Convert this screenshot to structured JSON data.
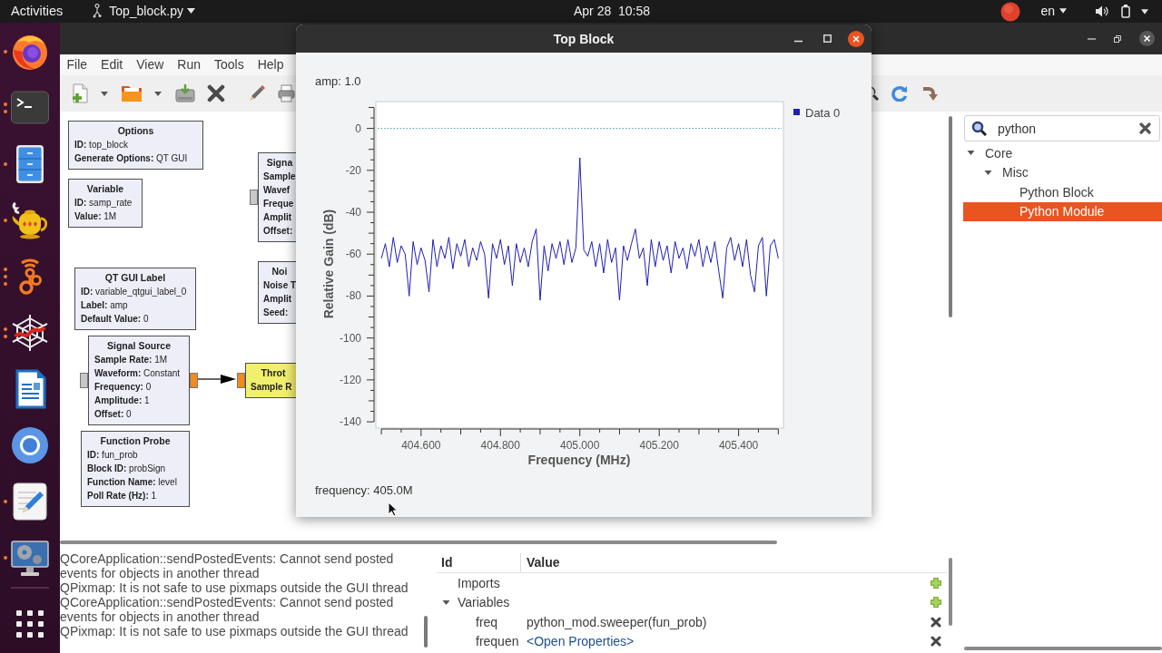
{
  "top_bar": {
    "activities": "Activities",
    "app_menu": "Top_block.py",
    "clock": "Apr 28  10:58",
    "keyboard_layout": "en"
  },
  "dock": [
    {
      "kind": "browser",
      "dots": [
        {
          "lit": true
        }
      ]
    },
    {
      "kind": "terminal",
      "dots": [
        {
          "lit": true
        },
        {
          "lit": true
        }
      ]
    },
    {
      "kind": "files",
      "dots": [
        {
          "lit": true
        }
      ]
    },
    {
      "kind": "teapot",
      "dots": [
        {
          "lit": true
        }
      ]
    },
    {
      "kind": "radio",
      "dots": [
        {
          "lit": true
        },
        {
          "lit": true
        },
        {
          "lit": true
        }
      ]
    },
    {
      "kind": "web",
      "dots": [
        {
          "lit": true
        },
        {
          "lit": true
        }
      ]
    },
    {
      "kind": "writer"
    },
    {
      "kind": "globe"
    },
    {
      "kind": "editor",
      "dots": [
        {
          "lit": true
        }
      ]
    },
    {
      "kind": "media",
      "dots": [
        {
          "lit": true
        }
      ]
    }
  ],
  "editor_window": {
    "menu": [
      "File",
      "Edit",
      "View",
      "Run",
      "Tools",
      "Help"
    ],
    "blocks": [
      {
        "title": "Options",
        "color": "#eeeef8",
        "params": [
          {
            "name": "ID:",
            "value": "top_block"
          },
          {
            "name": "Generate Options:",
            "value": "QT GUI"
          }
        ]
      },
      {
        "title": "Variable",
        "color": "#eeeef8",
        "params": [
          {
            "name": "ID:",
            "value": "samp_rate"
          },
          {
            "name": "Value:",
            "value": "1M"
          }
        ]
      },
      {
        "title": "Signa",
        "color": "#eeeef8",
        "params": [
          {
            "name": "Sample"
          },
          {
            "name": "Wavef"
          },
          {
            "name": "Freque"
          },
          {
            "name": "Amplit"
          },
          {
            "name": "Offset:"
          }
        ],
        "ports": [
          {
            "kind": "input",
            "color": "#c8c8c8"
          }
        ]
      },
      {
        "title": "QT GUI Label",
        "color": "#eeeef8",
        "params": [
          {
            "name": "ID:",
            "value": "variable_qtgui_label_0"
          },
          {
            "name": "Label:",
            "value": "amp"
          },
          {
            "name": "Default Value:",
            "value": "0"
          }
        ]
      },
      {
        "title": "Noi",
        "color": "#eeeef8",
        "params": [
          {
            "name": "Noise T"
          },
          {
            "name": "Amplit"
          },
          {
            "name": "Seed:"
          }
        ]
      },
      {
        "title": "Signal Source",
        "color": "#eeeef8",
        "params": [
          {
            "name": "Sample Rate:",
            "value": "1M"
          },
          {
            "name": "Waveform:",
            "value": "Constant"
          },
          {
            "name": "Frequency:",
            "value": "0"
          },
          {
            "name": "Amplitude:",
            "value": "1"
          },
          {
            "name": "Offset:",
            "value": "0"
          }
        ],
        "ports": [
          {
            "kind": "input",
            "color": "#c8c8c8"
          },
          {
            "kind": "output",
            "color": "#f28b1e"
          }
        ]
      },
      {
        "title": "Throt",
        "color": "#f2ee6e",
        "params": [
          {
            "name": "Sample R"
          }
        ],
        "ports": [
          {
            "kind": "input",
            "color": "#f28b1e"
          }
        ]
      },
      {
        "title": "Function Probe",
        "color": "#eeeef8",
        "params": [
          {
            "name": "ID:",
            "value": "fun_prob"
          },
          {
            "name": "Block ID:",
            "value": "probSign"
          },
          {
            "name": "Function Name:",
            "value": "level"
          },
          {
            "name": "Poll Rate (Hz):",
            "value": "1"
          }
        ]
      }
    ],
    "console": [
      "QCoreApplication::sendPostedEvents: Cannot send posted events for objects in another thread",
      "QPixmap: It is not safe to use pixmaps outside the GUI thread",
      "QCoreApplication::sendPostedEvents: Cannot send posted events for objects in another thread",
      "QPixmap: It is not safe to use pixmaps outside the GUI thread"
    ],
    "variables": {
      "columns": [
        "Id",
        "Value"
      ],
      "rows": [
        {
          "id": "Imports",
          "kind": "category"
        },
        {
          "id": "Variables",
          "kind": "category",
          "expanded": true,
          "children": [
            {
              "id": "freq",
              "kind": "variable",
              "value": "python_mod.sweeper(fun_prob)",
              "link": false
            },
            {
              "id": "frequen",
              "kind": "variable",
              "value": "<Open Properties>",
              "link": true
            }
          ]
        }
      ]
    },
    "block_library": {
      "search": {
        "value": "python"
      },
      "tree": [
        {
          "label": "Core",
          "expanded": true,
          "selected": false,
          "children": [
            {
              "label": "Misc",
              "expanded": true,
              "selected": false,
              "children": [
                {
                  "label": "Python Block",
                  "selected": false
                },
                {
                  "label": "Python Module",
                  "selected": true
                }
              ]
            }
          ]
        }
      ]
    }
  },
  "top_block_window": {
    "title": "Top Block",
    "amp_label": "amp: 1.0",
    "chart_data": {
      "type": "line",
      "xlabel": "Frequency (MHz)",
      "ylabel": "Relative Gain (dB)",
      "x": [
        404.5,
        404.51,
        404.52,
        404.53,
        404.54,
        404.55,
        404.56,
        404.57,
        404.58,
        404.59,
        404.6,
        404.61,
        404.62,
        404.63,
        404.64,
        404.65,
        404.66,
        404.67,
        404.68,
        404.69,
        404.7,
        404.71,
        404.72,
        404.73,
        404.74,
        404.75,
        404.76,
        404.77,
        404.78,
        404.79,
        404.8,
        404.81,
        404.82,
        404.83,
        404.84,
        404.85,
        404.86,
        404.87,
        404.88,
        404.89,
        404.9,
        404.91,
        404.92,
        404.93,
        404.94,
        404.95,
        404.96,
        404.97,
        404.98,
        404.99,
        405,
        405.01,
        405.02,
        405.03,
        405.04,
        405.05,
        405.06,
        405.07,
        405.08,
        405.09,
        405.1,
        405.11,
        405.12,
        405.13,
        405.14,
        405.15,
        405.16,
        405.17,
        405.18,
        405.19,
        405.2,
        405.21,
        405.22,
        405.23,
        405.24,
        405.25,
        405.26,
        405.27,
        405.28,
        405.29,
        405.3,
        405.31,
        405.32,
        405.33,
        405.34,
        405.35,
        405.36,
        405.37,
        405.38,
        405.39,
        405.4,
        405.41,
        405.42,
        405.43,
        405.44,
        405.45,
        405.46,
        405.47,
        405.48,
        405.49,
        405.5
      ],
      "series": [
        {
          "name": "Data 0",
          "color": "#1f1fb4",
          "values": [
            -62,
            -55,
            -66,
            -52,
            -64,
            -56,
            -60,
            -80,
            -54,
            -65,
            -57,
            -63,
            -78,
            -53,
            -66,
            -56,
            -62,
            -52,
            -67,
            -55,
            -61,
            -53,
            -66,
            -57,
            -63,
            -54,
            -60,
            -81,
            -55,
            -62,
            -53,
            -65,
            -56,
            -75,
            -55,
            -64,
            -57,
            -66,
            -54,
            -48,
            -82,
            -56,
            -68,
            -55,
            -62,
            -54,
            -65,
            -53,
            -64,
            -57,
            -14,
            -58,
            -61,
            -54,
            -66,
            -55,
            -69,
            -53,
            -64,
            -57,
            -82,
            -56,
            -63,
            -55,
            -48,
            -62,
            -57,
            -75,
            -53,
            -66,
            -54,
            -63,
            -56,
            -69,
            -54,
            -62,
            -57,
            -67,
            -55,
            -61,
            -53,
            -66,
            -56,
            -64,
            -54,
            -68,
            -81,
            -57,
            -52,
            -63,
            -55,
            -66,
            -53,
            -70,
            -78,
            -56,
            -52,
            -80,
            -56,
            -53,
            -62
          ]
        }
      ],
      "xlim": [
        404.486,
        405.513
      ],
      "ylim": [
        -143,
        12.8
      ],
      "xticks": [
        {
          "value": 404.6,
          "label": "404.600"
        },
        {
          "value": 404.8,
          "label": "404.800"
        },
        {
          "value": 405,
          "label": "405.000"
        },
        {
          "value": 405.2,
          "label": "405.200"
        },
        {
          "value": 405.4,
          "label": "405.400"
        }
      ],
      "yticks": [
        {
          "value": 0,
          "label": "0"
        },
        {
          "value": -20,
          "label": "-20"
        },
        {
          "value": -40,
          "label": "-40"
        },
        {
          "value": -60,
          "label": "-60"
        },
        {
          "value": -80,
          "label": "-80"
        },
        {
          "value": -100,
          "label": "-100"
        },
        {
          "value": -120,
          "label": "-120"
        },
        {
          "value": -140,
          "label": "-140"
        }
      ],
      "ref_lines": [
        {
          "axis": "y",
          "value": 0
        }
      ]
    },
    "frequency_label": "frequency: 405.0M"
  }
}
